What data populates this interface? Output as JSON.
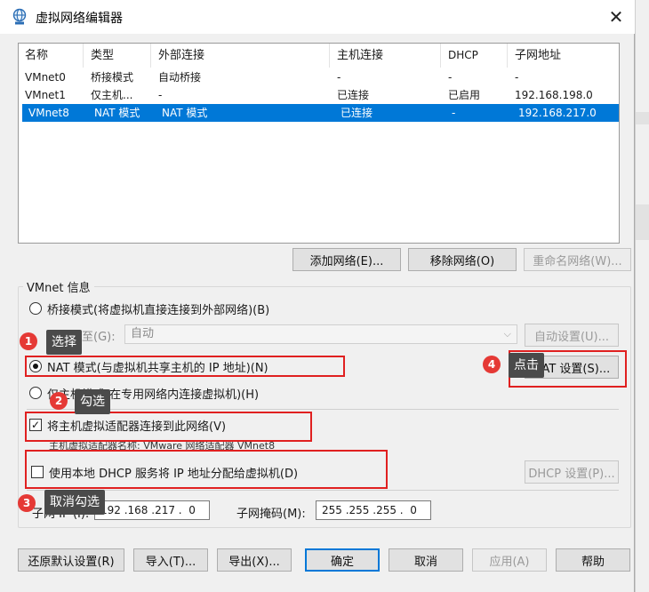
{
  "window": {
    "title": "虚拟网络编辑器",
    "close": "✕"
  },
  "table": {
    "headers": [
      "名称",
      "类型",
      "外部连接",
      "主机连接",
      "DHCP",
      "子网地址"
    ],
    "rows": [
      [
        "VMnet0",
        "桥接模式",
        "自动桥接",
        "-",
        "-",
        "-"
      ],
      [
        "VMnet1",
        "仅主机...",
        "-",
        "已连接",
        "已启用",
        "192.168.198.0"
      ],
      [
        "VMnet8",
        "NAT 模式",
        "NAT 模式",
        "已连接",
        "-",
        "192.168.217.0"
      ]
    ],
    "selected_row": 2
  },
  "list_buttons": {
    "add": "添加网络(E)...",
    "remove": "移除网络(O)",
    "rename": "重命名网络(W)..."
  },
  "group": {
    "title": "VMnet 信息",
    "bridge_radio": "桥接模式(将虚拟机直接连接到外部网络)(B)",
    "bridge_to_label": "已桥接至(G):",
    "bridge_to_value": "自动",
    "auto_settings": "自动设置(U)...",
    "nat_radio": "NAT 模式(与虚拟机共享主机的 IP 地址)(N)",
    "nat_settings": "NAT 设置(S)...",
    "hostonly_radio": "仅主机模式(在专用网络内连接虚拟机)(H)",
    "connect_adapter": "将主机虚拟适配器连接到此网络(V)",
    "adapter_name": "主机虚拟适配器名称: VMware 网络适配器 VMnet8",
    "use_dhcp": "使用本地 DHCP 服务将 IP 地址分配给虚拟机(D)",
    "dhcp_settings": "DHCP 设置(P)...",
    "subnet_ip_label": "子网 IP (I):",
    "subnet_ip_value": "192 .168 .217 .  0",
    "mask_label": "子网掩码(M):",
    "mask_value": "255 .255 .255 .  0"
  },
  "footer": {
    "restore": "还原默认设置(R)",
    "import": "导入(T)...",
    "export": "导出(X)...",
    "ok": "确定",
    "cancel": "取消",
    "apply": "应用(A)",
    "help": "帮助"
  },
  "annotations": [
    {
      "num": "1",
      "text": "选择"
    },
    {
      "num": "2",
      "text": "勾选"
    },
    {
      "num": "3",
      "text": "取消勾选"
    },
    {
      "num": "4",
      "text": "点击"
    }
  ],
  "colors": {
    "selection": "#0078d7",
    "annotation": "#e02020",
    "tooltip_bg": "#4a4a4a"
  }
}
